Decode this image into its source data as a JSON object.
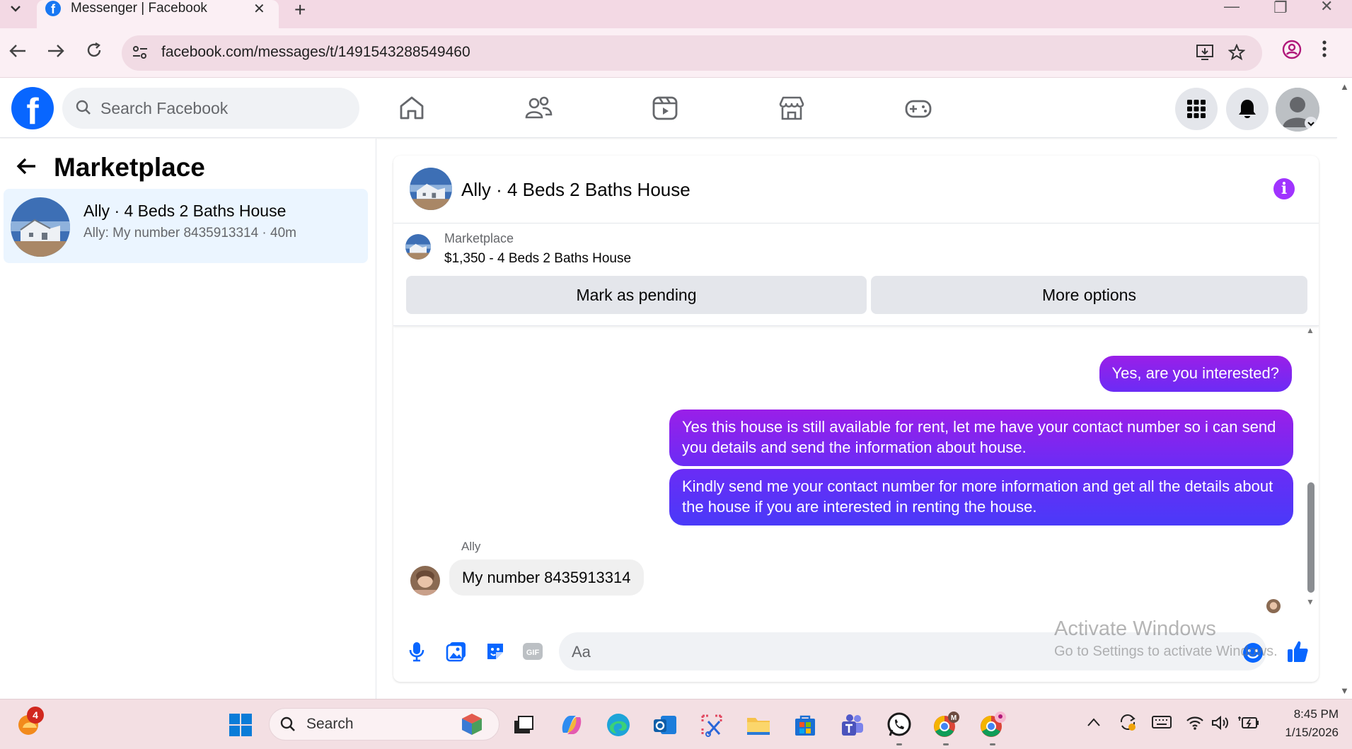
{
  "browser": {
    "tab_title": "Messenger | Facebook",
    "url": "facebook.com/messages/t/1491543288549460",
    "colors": {
      "chrome": "#f3d9e4",
      "toolbar": "#fbeff4"
    }
  },
  "fb": {
    "logo": "f",
    "search_placeholder": "Search Facebook",
    "nav_icons": [
      "home-icon",
      "friends-icon",
      "video-icon",
      "marketplace-icon",
      "gaming-icon"
    ],
    "brand_color": "#0866ff"
  },
  "sidebar": {
    "title": "Marketplace",
    "conversation": {
      "name": "Ally · 4 Beds 2 Baths House",
      "preview": "Ally: My number 8435913314 · 40m"
    }
  },
  "chat": {
    "header_name": "Ally · 4 Beds 2 Baths House",
    "info_glyph": "i",
    "listing": {
      "label": "Marketplace",
      "item": "$1,350 - 4 Beds 2 Baths House",
      "mark_pending": "Mark as pending",
      "more_options": "More options"
    },
    "messages": {
      "out_1": "Yes, are you interested?",
      "out_2": "Yes this house is still available for rent, let me have your contact number so i can send you details and send the information about house.",
      "out_3": "Kindly send me your contact number for more information and get all the details about the house if you are interested in renting the house.",
      "sender": "Ally",
      "in_1": "My number  8435913314"
    },
    "composer_placeholder": "Aa",
    "accent_color": "#7b2ff7"
  },
  "watermark": {
    "line1": "Activate Windows",
    "line2": "Go to Settings to activate Windows."
  },
  "taskbar": {
    "search_label": "Search",
    "notification_count": "4",
    "time": "8:45 PM",
    "date": "1/15/2026"
  }
}
